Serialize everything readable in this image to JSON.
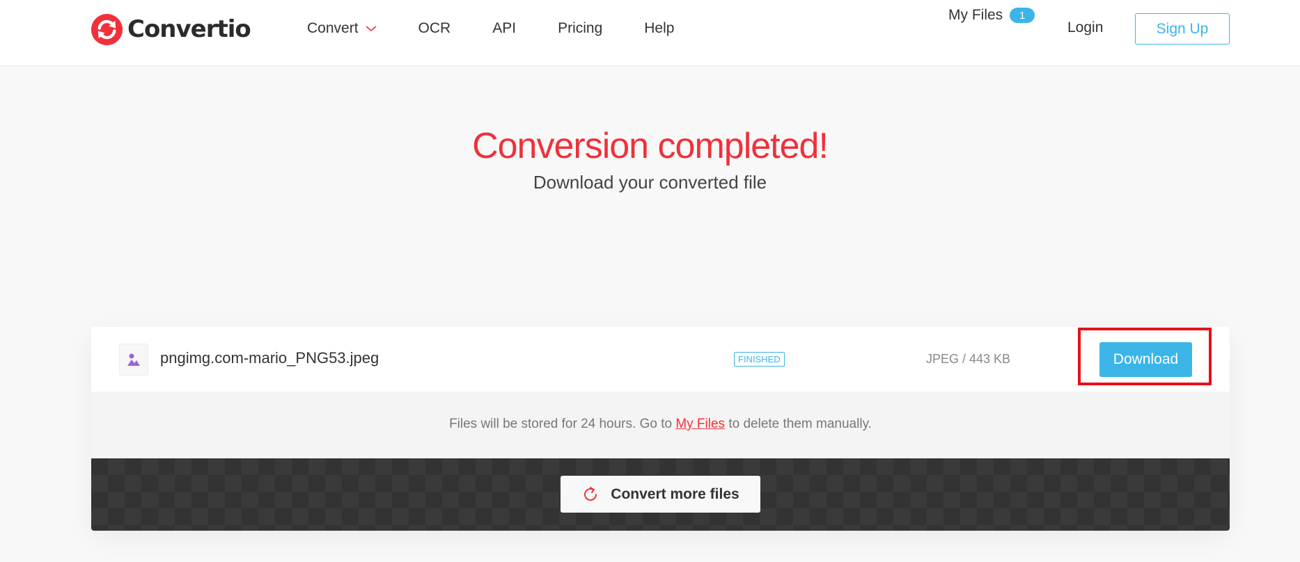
{
  "header": {
    "brand": "Convertio",
    "nav": [
      {
        "label": "Convert",
        "has_dropdown": true
      },
      {
        "label": "OCR"
      },
      {
        "label": "API"
      },
      {
        "label": "Pricing"
      },
      {
        "label": "Help"
      }
    ],
    "my_files_label": "My Files",
    "my_files_count": "1",
    "login_label": "Login",
    "signup_label": "Sign Up"
  },
  "hero": {
    "title": "Conversion completed!",
    "subtitle": "Download your converted file"
  },
  "file": {
    "name": "pngimg.com-mario_PNG53.jpeg",
    "status": "FINISHED",
    "info": "JPEG / 443 KB",
    "download_label": "Download"
  },
  "note": {
    "prefix": "Files will be stored for 24 hours. Go to ",
    "link": "My Files",
    "suffix": " to delete them manually."
  },
  "actions": {
    "convert_more_label": "Convert more files"
  },
  "colors": {
    "accent_red": "#f1303a",
    "accent_blue": "#3bb5e8",
    "highlight": "#e8101a"
  },
  "icons": {
    "logo": "convertio-logo-icon",
    "file": "image-file-icon",
    "refresh": "refresh-icon",
    "dropdown": "chevron-down-icon"
  }
}
